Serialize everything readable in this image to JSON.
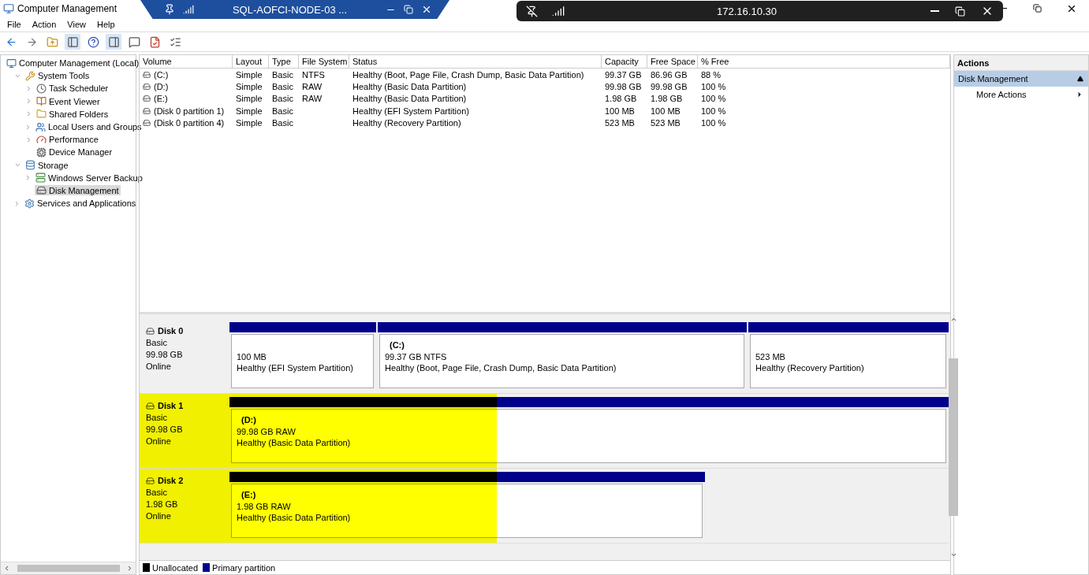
{
  "window": {
    "title": "Computer Management"
  },
  "menu": [
    "File",
    "Action",
    "View",
    "Help"
  ],
  "remote_tab": {
    "title": "SQL-AOFCI-NODE-03 ..."
  },
  "remote_bar": {
    "address": "172.16.10.30"
  },
  "tree": [
    {
      "label": "Computer Management (Local)",
      "selected": false,
      "children": [
        {
          "label": "System Tools",
          "expanded": true,
          "selected": false,
          "children": [
            {
              "label": "Task Scheduler",
              "expanded": false,
              "selected": false
            },
            {
              "label": "Event Viewer",
              "expanded": false,
              "selected": false
            },
            {
              "label": "Shared Folders",
              "expanded": false,
              "selected": false
            },
            {
              "label": "Local Users and Groups",
              "expanded": false,
              "selected": false
            },
            {
              "label": "Performance",
              "expanded": false,
              "selected": false
            },
            {
              "label": "Device Manager",
              "selected": false
            }
          ]
        },
        {
          "label": "Storage",
          "expanded": true,
          "selected": false,
          "children": [
            {
              "label": "Windows Server Backup",
              "expanded": false,
              "selected": false
            },
            {
              "label": "Disk Management",
              "selected": true
            }
          ]
        },
        {
          "label": "Services and Applications",
          "expanded": false,
          "selected": false
        }
      ]
    }
  ],
  "table": {
    "columns": [
      "Volume",
      "Layout",
      "Type",
      "File System",
      "Status",
      "Capacity",
      "Free Space",
      "% Free"
    ],
    "rows": [
      [
        "(C:)",
        "Simple",
        "Basic",
        "NTFS",
        "Healthy (Boot, Page File, Crash Dump, Basic Data Partition)",
        "99.37 GB",
        "86.96 GB",
        "88 %"
      ],
      [
        "(D:)",
        "Simple",
        "Basic",
        "RAW",
        "Healthy (Basic Data Partition)",
        "99.98 GB",
        "99.98 GB",
        "100 %"
      ],
      [
        "(E:)",
        "Simple",
        "Basic",
        "RAW",
        "Healthy (Basic Data Partition)",
        "1.98 GB",
        "1.98 GB",
        "100 %"
      ],
      [
        "(Disk 0 partition 1)",
        "Simple",
        "Basic",
        "",
        "Healthy (EFI System Partition)",
        "100 MB",
        "100 MB",
        "100 %"
      ],
      [
        "(Disk 0 partition 4)",
        "Simple",
        "Basic",
        "",
        "Healthy (Recovery Partition)",
        "523 MB",
        "523 MB",
        "100 %"
      ]
    ]
  },
  "disks": [
    {
      "name": "Disk 0",
      "type": "Basic",
      "size": "99.98 GB",
      "state": "Online",
      "highlighted": false,
      "partitions": [
        {
          "size": "100 MB",
          "status": "Healthy (EFI System Partition)"
        },
        {
          "label": "(C:)",
          "size": "99.37 GB NTFS",
          "status": "Healthy (Boot, Page File, Crash Dump, Basic Data Partition)"
        },
        {
          "size": "523 MB",
          "status": "Healthy (Recovery Partition)"
        }
      ]
    },
    {
      "name": "Disk 1",
      "type": "Basic",
      "size": "99.98 GB",
      "state": "Online",
      "highlighted": true,
      "partitions": [
        {
          "label": "(D:)",
          "size": "99.98 GB RAW",
          "status": "Healthy (Basic Data Partition)"
        }
      ]
    },
    {
      "name": "Disk 2",
      "type": "Basic",
      "size": "1.98 GB",
      "state": "Online",
      "highlighted": true,
      "partitions": [
        {
          "label": "(E:)",
          "size": "1.98 GB RAW",
          "status": "Healthy (Basic Data Partition)"
        }
      ]
    }
  ],
  "legend": [
    {
      "label": "Unallocated",
      "color": "#000000"
    },
    {
      "label": "Primary partition",
      "color": "#00008b"
    }
  ],
  "actions": {
    "title": "Actions",
    "section": "Disk Management",
    "items": [
      "More Actions"
    ]
  }
}
